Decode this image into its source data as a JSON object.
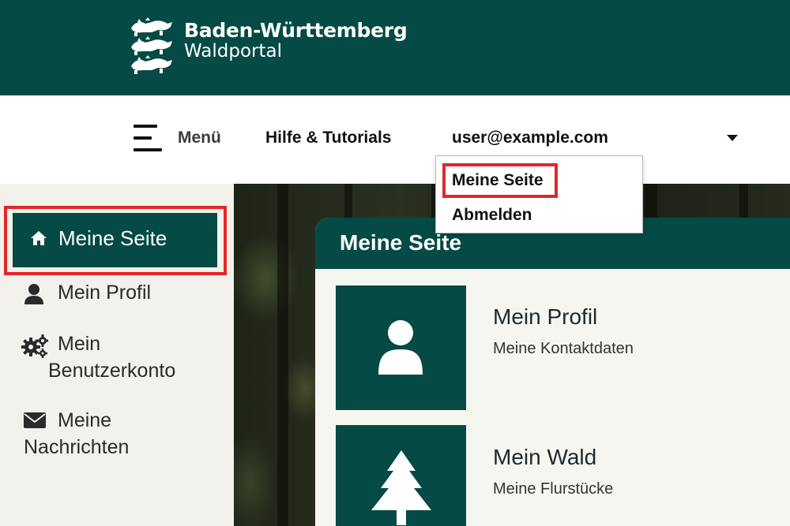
{
  "header": {
    "brand_title": "Baden-Württemberg",
    "brand_subtitle": "Waldportal",
    "logo_icon": "three-lions-coat-of-arms-icon",
    "background_color": "#054a44"
  },
  "navbar": {
    "menu_label": "Menü",
    "help_label": "Hilfe & Tutorials",
    "user_label": "user@example.com"
  },
  "dropdown": {
    "items": [
      {
        "label": "Meine Seite",
        "highlighted": true
      },
      {
        "label": "Abmelden"
      }
    ]
  },
  "sidebar": {
    "items": [
      {
        "label": "Meine Seite",
        "icon": "home-icon",
        "active": true
      },
      {
        "label": "Mein Profil",
        "icon": "user-icon"
      },
      {
        "label_line1": "Mein",
        "label_line2": "Benutzerkonto",
        "icon": "gears-icon"
      },
      {
        "label_line1": "Meine",
        "label_line2": "Nachrichten",
        "icon": "envelope-icon"
      }
    ]
  },
  "main": {
    "title": "Meine Seite",
    "tiles": [
      {
        "title": "Mein Profil",
        "subtitle": "Meine Kontaktdaten",
        "icon": "user-icon"
      },
      {
        "title": "Mein Wald",
        "subtitle": "Meine Flurstücke",
        "icon": "fir-tree-icon"
      }
    ]
  },
  "colors": {
    "primary": "#054a44",
    "highlight": "#e3262b",
    "sidebar_bg": "#f3f1eb"
  }
}
